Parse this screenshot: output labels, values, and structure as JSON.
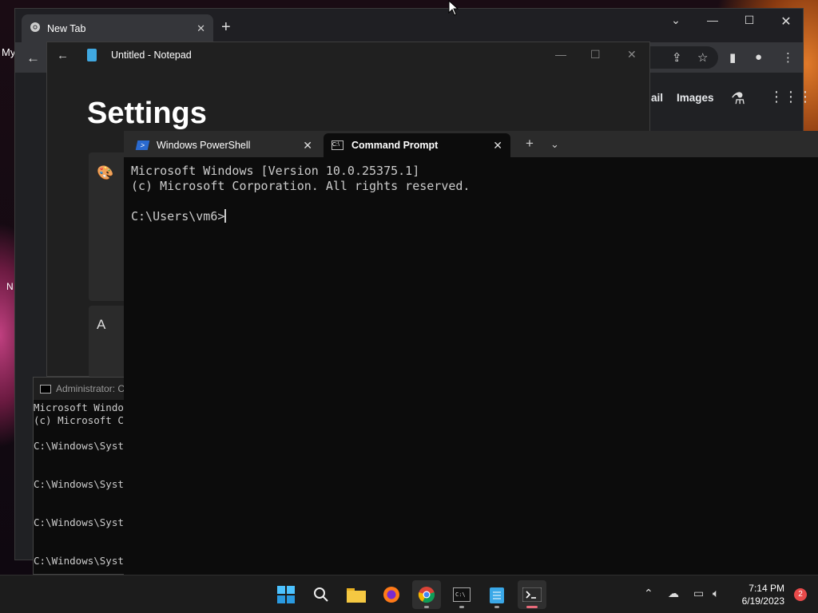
{
  "desktop": {
    "label_top": "My",
    "label_mid": "N"
  },
  "chrome": {
    "tab_title": "New Tab",
    "links": [
      "ail",
      "Images"
    ]
  },
  "notepad": {
    "title": "Untitled - Notepad",
    "heading": "Settings"
  },
  "admin_cmd": {
    "title": "Administrator: C",
    "lines": [
      "Microsoft Windo",
      "(c) Microsoft C",
      "",
      "C:\\Windows\\Syst",
      "",
      "",
      "C:\\Windows\\Syst",
      "",
      "",
      "C:\\Windows\\Syst",
      "",
      "",
      "C:\\Windows\\Syst"
    ]
  },
  "terminal": {
    "tabs": [
      {
        "label": "Windows PowerShell",
        "active": false
      },
      {
        "label": "Command Prompt",
        "active": true
      }
    ],
    "output": "Microsoft Windows [Version 10.0.25375.1]\n(c) Microsoft Corporation. All rights reserved.\n\nC:\\Users\\vm6>"
  },
  "taskbar": {
    "apps": [
      "start",
      "search",
      "file-explorer",
      "firefox",
      "chrome",
      "terminal-pinned",
      "notepad",
      "windows-terminal"
    ],
    "time": "7:14 PM",
    "date": "6/19/2023",
    "notification_count": "2"
  },
  "colors": {
    "accent": "#e86a7a",
    "terminal_bg": "#0c0c0c",
    "chrome_bg": "#202124"
  }
}
